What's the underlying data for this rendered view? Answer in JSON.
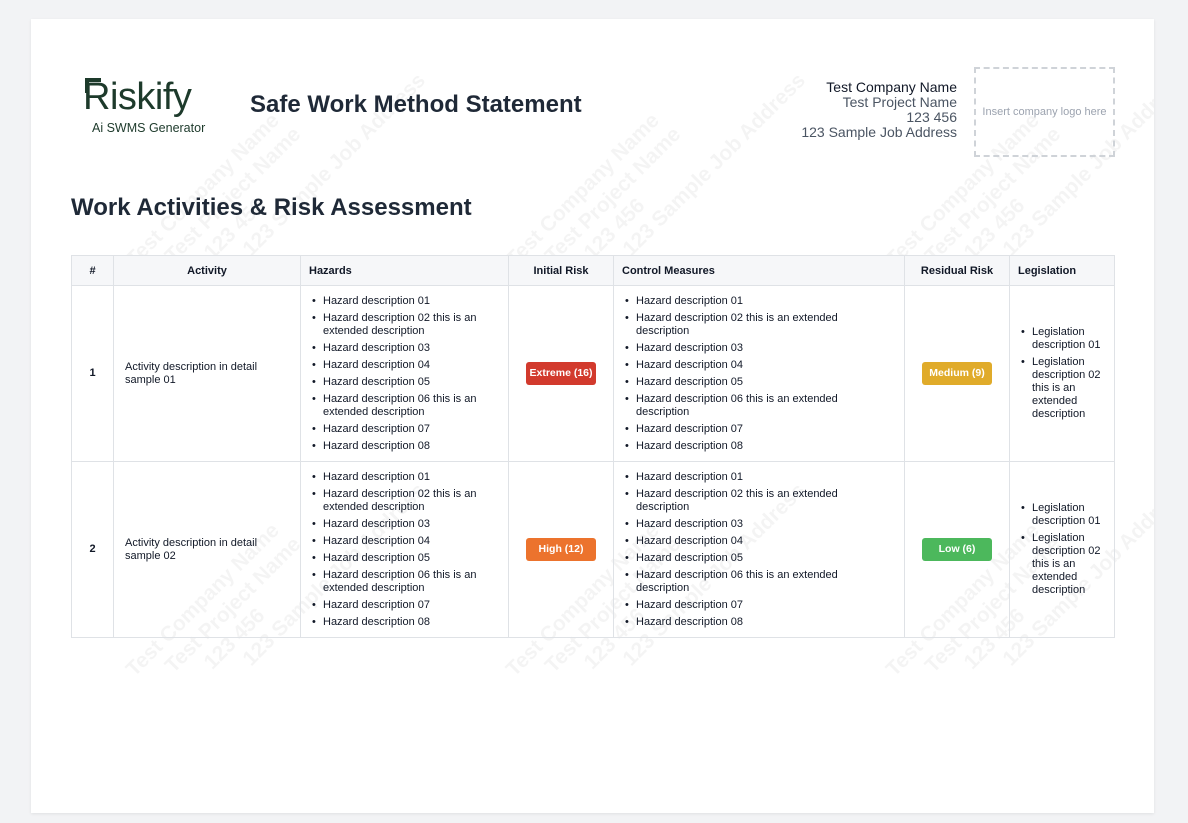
{
  "logo": {
    "word": "Riskify",
    "tagline": "Ai SWMS Generator"
  },
  "document_title": "Safe Work Method Statement",
  "company": {
    "name": "Test Company Name",
    "project": "Test Project Name",
    "number": "123 456",
    "address": "123 Sample Job Address",
    "logo_placeholder": "Insert company logo here"
  },
  "section_title": "Work Activities & Risk Assessment",
  "columns": [
    "#",
    "Activity",
    "Hazards",
    "Initial Risk",
    "Control Measures",
    "Residual Risk",
    "Legislation"
  ],
  "rows": [
    {
      "num": "1",
      "activity": "Activity description in detail sample 01",
      "hazards": [
        "Hazard description 01",
        "Hazard description 02 this is an extended description",
        "Hazard description 03",
        "Hazard description 04",
        "Hazard description 05",
        "Hazard description 06 this is an extended description",
        "Hazard description 07",
        "Hazard description 08"
      ],
      "initial_risk": {
        "label": "Extreme (16)",
        "color": "#d23a2d"
      },
      "controls": [
        "Hazard description 01",
        "Hazard description 02 this is an extended description",
        "Hazard description 03",
        "Hazard description 04",
        "Hazard description 05",
        "Hazard description 06 this is an extended description",
        "Hazard description 07",
        "Hazard description 08"
      ],
      "residual_risk": {
        "label": "Medium (9)",
        "color": "#e0ab2a"
      },
      "legislation": [
        "Legislation description 01",
        "Legislation description 02 this is an extended description"
      ]
    },
    {
      "num": "2",
      "activity": "Activity description in detail sample 02",
      "hazards": [
        "Hazard description 01",
        "Hazard description 02 this is an extended description",
        "Hazard description 03",
        "Hazard description 04",
        "Hazard description 05",
        "Hazard description 06 this is an extended description",
        "Hazard description 07",
        "Hazard description 08"
      ],
      "initial_risk": {
        "label": "High (12)",
        "color": "#ec732d"
      },
      "controls": [
        "Hazard description 01",
        "Hazard description 02 this is an extended description",
        "Hazard description 03",
        "Hazard description 04",
        "Hazard description 05",
        "Hazard description 06 this is an extended description",
        "Hazard description 07",
        "Hazard description 08"
      ],
      "residual_risk": {
        "label": "Low (6)",
        "color": "#4cb85c"
      },
      "legislation": [
        "Legislation description 01",
        "Legislation description 02 this is an extended description"
      ]
    }
  ]
}
